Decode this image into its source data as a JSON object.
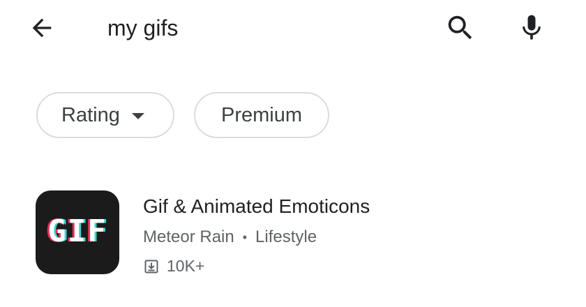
{
  "search": {
    "query": "my gifs"
  },
  "icons": {
    "back": "arrow-back-icon",
    "search": "search-icon",
    "mic": "mic-icon",
    "download": "download-icon"
  },
  "chips": [
    {
      "label": "Rating",
      "has_dropdown": true
    },
    {
      "label": "Premium",
      "has_dropdown": false
    }
  ],
  "results": [
    {
      "icon_text": "GIF",
      "title": "Gif & Animated Emoticons",
      "developer": "Meteor Rain",
      "category": "Lifestyle",
      "separator": "•",
      "downloads": "10K+"
    }
  ],
  "colors": {
    "text_primary": "#202124",
    "text_secondary": "#5f6368",
    "chip_border": "#dadce0",
    "icon_bg": "#1b1b1b"
  }
}
